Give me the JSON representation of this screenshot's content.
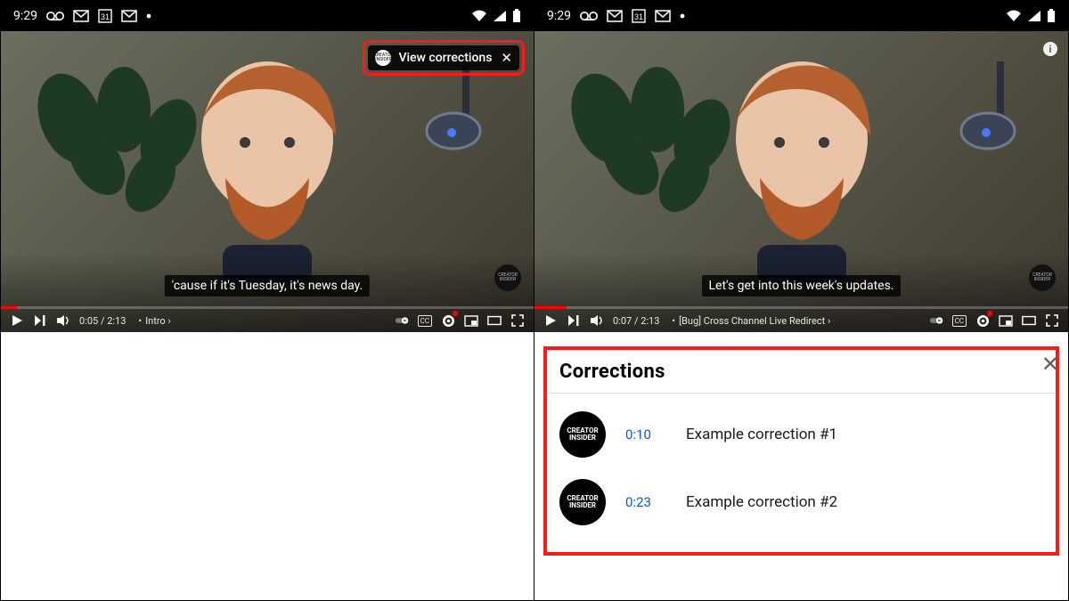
{
  "status": {
    "time": "9:29",
    "icons": [
      "voicemail",
      "gmail",
      "calendar-31",
      "gmail",
      "dot"
    ],
    "right_icons": [
      "wifi",
      "signal",
      "battery"
    ]
  },
  "left": {
    "caption": "'cause if it's Tuesday, it's news day.",
    "view_corrections_label": "View corrections",
    "timecode": "0:05 / 2:13",
    "chapter": "Intro",
    "channel_badge": "CREATOR INSIDER"
  },
  "right": {
    "caption": "Let's get into this week's updates.",
    "timecode": "0:07 / 2:13",
    "chapter": "[Bug] Cross Channel Live Redirect",
    "channel_badge": "CREATOR INSIDER"
  },
  "corrections": {
    "title": "Corrections",
    "avatar_label": "CREATOR INSIDER",
    "items": [
      {
        "time": "0:10",
        "text": "Example correction #1"
      },
      {
        "time": "0:23",
        "text": "Example correction #2"
      }
    ]
  },
  "controls": {
    "cc": "CC",
    "autoplay": "autoplay",
    "miniplayer": "miniplayer",
    "theater": "theater",
    "fullscreen": "fullscreen"
  }
}
